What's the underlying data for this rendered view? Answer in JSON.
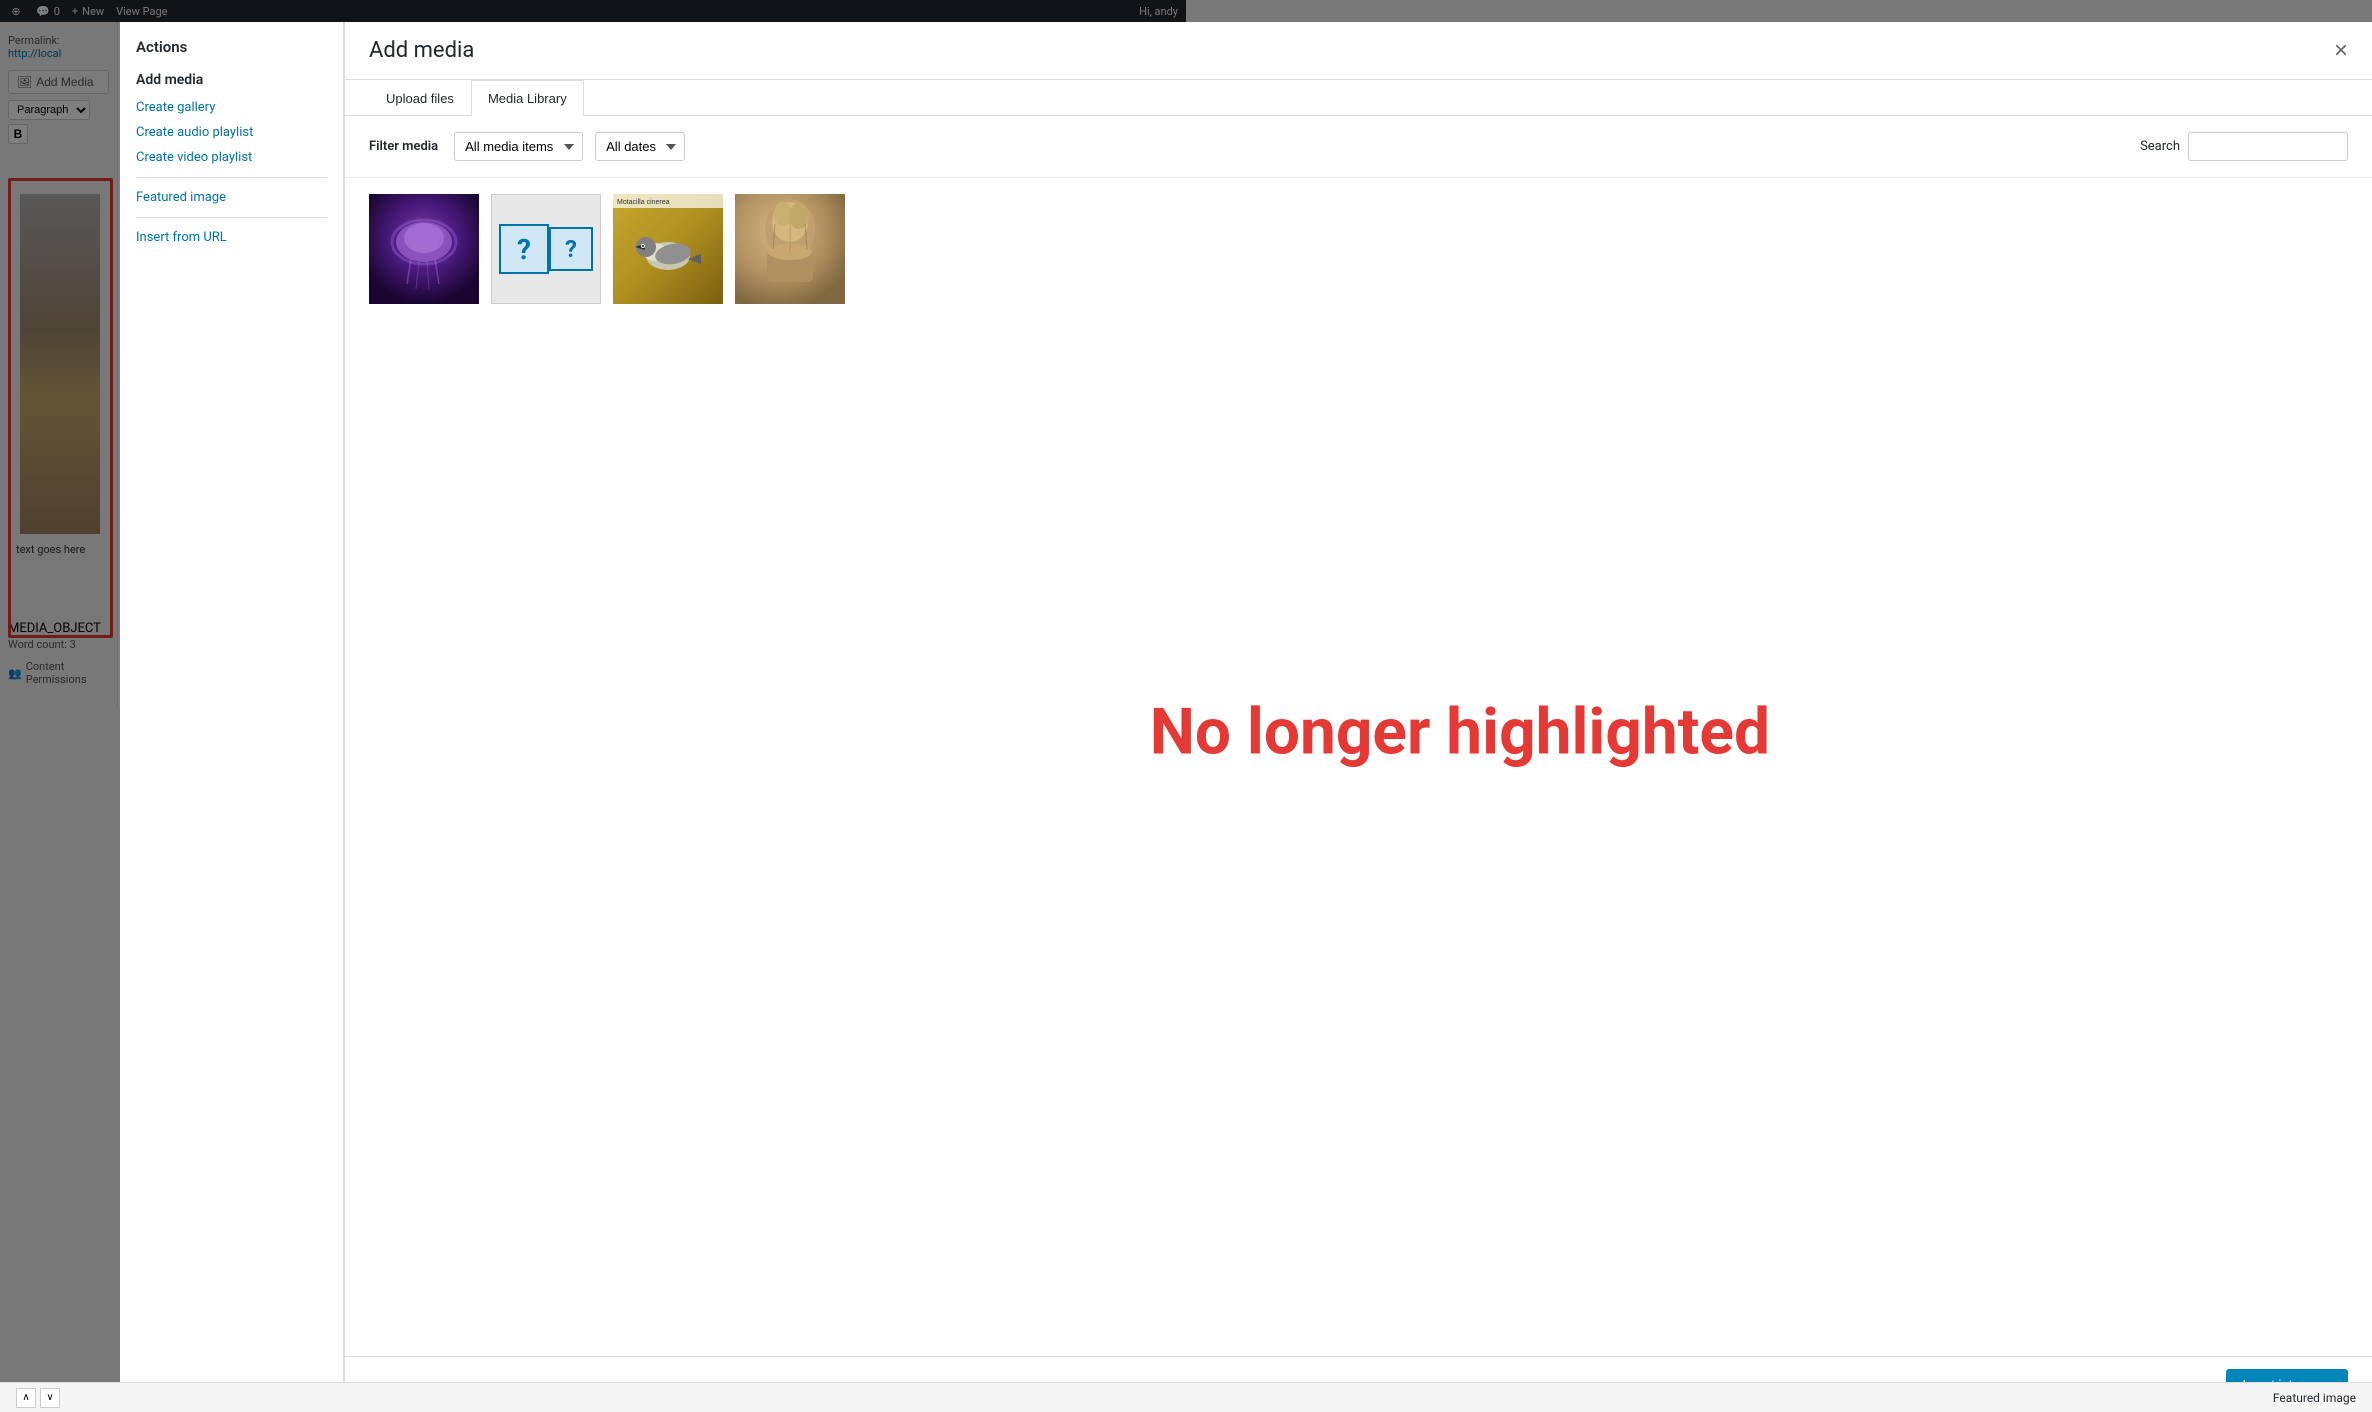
{
  "adminBar": {
    "comment_icon": "comment-icon",
    "comment_count": "0",
    "new_label": "New",
    "plus_icon": "plus-icon",
    "view_page_label": "View Page",
    "greeting": "Hi, andy"
  },
  "editor": {
    "permalink_label": "Permalink:",
    "permalink_url": "http://local",
    "add_media_label": "Add Media",
    "paragraph_label": "Paragraph",
    "media_object_label": "MEDIA_OBJECT",
    "word_count_label": "Word count: 3",
    "text_placeholder": "text goes here",
    "content_permissions_label": "Content Permissions"
  },
  "actions": {
    "title": "Actions",
    "add_media_label": "Add media",
    "create_gallery": "Create gallery",
    "create_audio_playlist": "Create audio playlist",
    "create_video_playlist": "Create video playlist",
    "featured_image": "Featured image",
    "insert_from_url": "Insert from URL"
  },
  "modal": {
    "title": "Add media",
    "close_label": "×",
    "tabs": [
      {
        "id": "upload-files",
        "label": "Upload files",
        "active": false
      },
      {
        "id": "media-library",
        "label": "Media Library",
        "active": true
      }
    ],
    "filter": {
      "label": "Filter media",
      "media_items_label": "All media items",
      "dates_label": "All dates",
      "search_label": "Search"
    },
    "media_items": [
      {
        "id": "thumb-1",
        "type": "purple",
        "alt": "Purple jellyfish image"
      },
      {
        "id": "thumb-2",
        "type": "unknown",
        "alt": "Unknown media file"
      },
      {
        "id": "thumb-3",
        "type": "bird",
        "alt": "Motacilla cinerea bird",
        "caption": "Motacilla cinerea"
      },
      {
        "id": "thumb-4",
        "type": "statue",
        "alt": "Stone statue"
      }
    ],
    "highlight_text": "No longer highlighted",
    "insert_button_label": "Insert into page"
  },
  "footer": {
    "featured_image_label": "Featured image"
  }
}
